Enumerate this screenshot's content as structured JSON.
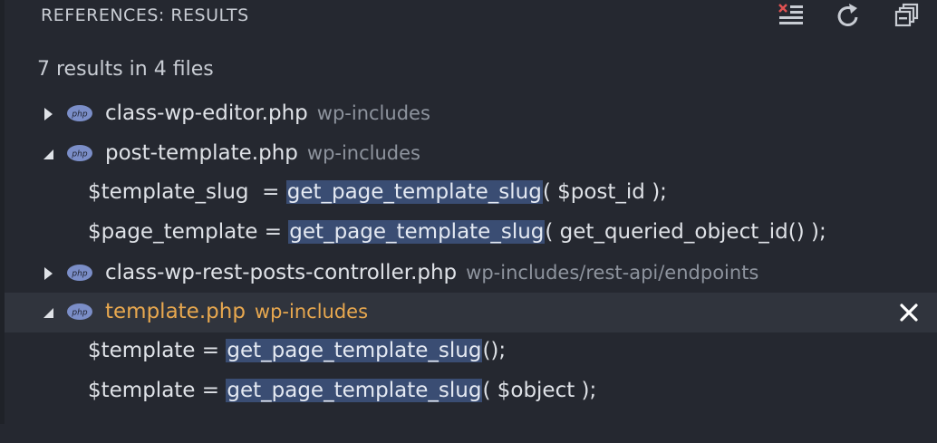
{
  "panel": {
    "title": "REFERENCES: RESULTS",
    "summary": "7 results in 4 files",
    "actions": {
      "clear": "clear-all-icon",
      "refresh": "refresh-icon",
      "collapse": "collapse-all-icon"
    }
  },
  "colors": {
    "background": "#252830",
    "selected_row": "#30343d",
    "highlight": "#3a4d73",
    "accent": "#e8a84f",
    "php_badge": "#7b8ec8"
  },
  "icon_label": "php",
  "files": [
    {
      "name": "class-wp-editor.php",
      "path": "wp-includes",
      "expanded": false
    },
    {
      "name": "post-template.php",
      "path": "wp-includes",
      "expanded": true,
      "matches": [
        {
          "before": "$template_slug  = ",
          "hl": "get_page_template_slug",
          "after": "( $post_id );"
        },
        {
          "before": "$page_template = ",
          "hl": "get_page_template_slug",
          "after": "( get_queried_object_id() );"
        }
      ]
    },
    {
      "name": "class-wp-rest-posts-controller.php",
      "path": "wp-includes/rest-api/endpoints",
      "expanded": false
    },
    {
      "name": "template.php",
      "path": "wp-includes",
      "expanded": true,
      "selected": true,
      "matches": [
        {
          "before": "$template = ",
          "hl": "get_page_template_slug",
          "after": "();"
        },
        {
          "before": "$template = ",
          "hl": "get_page_template_slug",
          "after": "( $object );"
        }
      ]
    }
  ]
}
